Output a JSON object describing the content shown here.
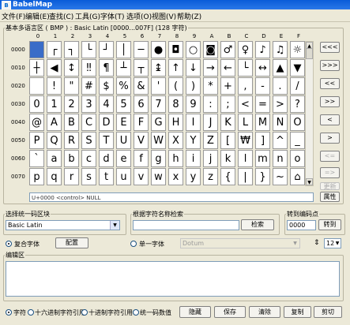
{
  "window": {
    "title": "BabelMap"
  },
  "menu": [
    "文件(F)",
    "编辑(E)",
    "查找(C)",
    "工具(G)",
    "字体(T)",
    "选项(O)",
    "视图(V)",
    "帮助(Z)"
  ],
  "grid_section": {
    "label": "基本多语言区 ( BMP ) : Basic Latin [0000...007F] (128 字符)",
    "col_headers": [
      "0",
      "1",
      "2",
      "3",
      "4",
      "5",
      "6",
      "7",
      "8",
      "9",
      "A",
      "B",
      "C",
      "D",
      "E",
      "F"
    ],
    "row_headers": [
      "0000",
      "0010",
      "0020",
      "0030",
      "0040",
      "0050",
      "0060",
      "0070"
    ],
    "rows": [
      [
        "",
        "┌",
        "┐",
        "└",
        "┘",
        "│",
        "─",
        "●",
        "◘",
        "○",
        "◙",
        "♂",
        "♀",
        "♪",
        "♫",
        "☼"
      ],
      [
        "┼",
        "◀",
        "↕",
        "‼",
        "¶",
        "┴",
        "┬",
        "↨",
        "↑",
        "↓",
        "→",
        "←",
        "└",
        "↔",
        "▲",
        "▼"
      ],
      [
        " ",
        "!",
        "\"",
        "#",
        "$",
        "%",
        "&",
        "'",
        "(",
        ")",
        "*",
        "+",
        ",",
        "-",
        ".",
        "/"
      ],
      [
        "0",
        "1",
        "2",
        "3",
        "4",
        "5",
        "6",
        "7",
        "8",
        "9",
        ":",
        ";",
        "<",
        "=",
        ">",
        "?"
      ],
      [
        "@",
        "A",
        "B",
        "C",
        "D",
        "E",
        "F",
        "G",
        "H",
        "I",
        "J",
        "K",
        "L",
        "M",
        "N",
        "O"
      ],
      [
        "P",
        "Q",
        "R",
        "S",
        "T",
        "U",
        "V",
        "W",
        "X",
        "Y",
        "Z",
        "[",
        "₩",
        "]",
        "^",
        "_"
      ],
      [
        "`",
        "a",
        "b",
        "c",
        "d",
        "e",
        "f",
        "g",
        "h",
        "i",
        "j",
        "k",
        "l",
        "m",
        "n",
        "o"
      ],
      [
        "p",
        "q",
        "r",
        "s",
        "t",
        "u",
        "v",
        "w",
        "x",
        "y",
        "z",
        "{",
        "|",
        "}",
        "~",
        "⌂"
      ]
    ],
    "status": "U+0000 <control> NULL",
    "props_button": "属性"
  },
  "nav_buttons": [
    "<<<",
    ">>>",
    "<<",
    ">>",
    "<",
    ">",
    "<=",
    "=>",
    "更新"
  ],
  "block_select": {
    "label": "选择统一码区块",
    "value": "Basic Latin"
  },
  "name_search": {
    "label": "根据字符名称检索",
    "value": "",
    "button": "检索"
  },
  "goto": {
    "label": "转到编码点",
    "value": "0000",
    "button": "转到"
  },
  "font_mode": {
    "composite": "复合字体",
    "config": "配置",
    "single": "单一字体",
    "font_value": "Dotum",
    "size_value": "12"
  },
  "edit_area": {
    "label": "编辑区",
    "value": ""
  },
  "output_modes": [
    "字符",
    "十六进制字符引用",
    "十进制字符引用",
    "统一码数值"
  ],
  "actions": {
    "hide": "隐藏",
    "save": "保存",
    "clear": "清除",
    "copy": "复制",
    "cut": "剪切"
  }
}
